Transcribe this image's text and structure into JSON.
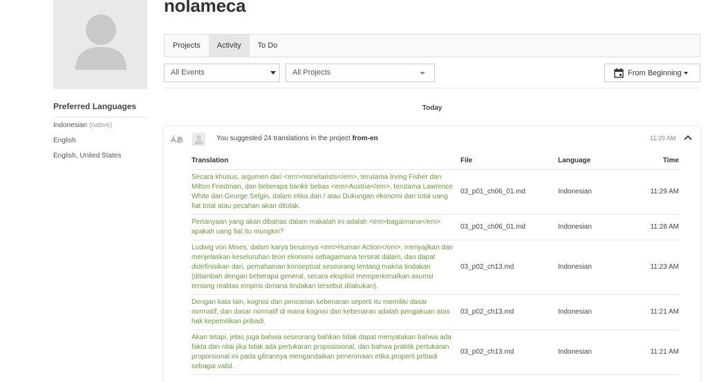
{
  "user": {
    "username": "nolameca"
  },
  "sidebar": {
    "preferred_languages_title": "Preferred Languages",
    "languages": [
      {
        "name": "Indonesian",
        "note": "(native)"
      },
      {
        "name": "English",
        "note": ""
      },
      {
        "name": "English, United States",
        "note": ""
      }
    ]
  },
  "tabs": [
    {
      "label": "Projects",
      "active": false
    },
    {
      "label": "Activity",
      "active": true
    },
    {
      "label": "To Do",
      "active": false
    }
  ],
  "filters": {
    "events": "All Events",
    "projects": "All Projects",
    "date_range": "From Beginning"
  },
  "activity": {
    "day_label": "Today",
    "summary_prefix": "You suggested 24 translations in the project",
    "project_name": "from-en",
    "time": "11:29 AM",
    "columns": {
      "translation": "Translation",
      "file": "File",
      "language": "Language",
      "time": "Time"
    },
    "rows": [
      {
        "translation": "Secara khusus, argumen dari <em>monetarists</em>, terutama Irving Fisher dan Milton Friedman, dan beberapa bankir bebas <em>Austria</em>, terutama Lawrence White dan George Selgin, dalam etika dan / atau Dukungan ekonomi dari total uang fiat total atau pecahan akan ditolak.",
        "file": "03_p01_ch06_01.md",
        "language": "Indonesian",
        "time": "11:29 AM"
      },
      {
        "translation": "Pertanyaan yang akan dibahas dalam makalah ini adalah <em>bagaimana</em> apakah uang fiat itu mungkin?",
        "file": "03_p01_ch06_01.md",
        "language": "Indonesian",
        "time": "11:28 AM"
      },
      {
        "translation": "Ludwig von Mises, dalam karya besarnya <em>Human Action</em>, menyajikan dan menjelaskan keseluruhan teori ekonomi sebagaimana tersirat dalam, dan dapat didefinisikan dari, pemahaman konseptual seseorang tentang makna tindakan (ditambah dengan beberapa general, secara eksplisit memperkenalkan asumsi tentang realitas empiris dimana tindakan tersebut dilakukan).",
        "file": "03_p02_ch13.md",
        "language": "Indonesian",
        "time": "11:23 AM"
      },
      {
        "translation": "Dengan kata lain, kognisi dan pencarian kebenaran seperti itu memiliki dasar normatif, dan dasar normatif di mana kognisi dan kebenaran adalah pengakuan atas hak kepemilikan pribadi.",
        "file": "03_p02_ch13.md",
        "language": "Indonesian",
        "time": "11:21 AM"
      },
      {
        "translation": "Akan tetapi, jelas juga bahwa seseorang bahkan tidak dapat menyatakan bahwa ada fakta dan nilai jika tidak ada pertukaran proposisional, dan bahwa praktik pertukaran proporsional ini pada gilirannya mengandaikan penerimaan etika properti pribadi sebagai valid.",
        "file": "03_p02_ch13.md",
        "language": "Indonesian",
        "time": "11:21 AM"
      }
    ]
  },
  "colors": {
    "translation_text": "#6a9a3a",
    "active_tab": "#e6e6e6"
  }
}
